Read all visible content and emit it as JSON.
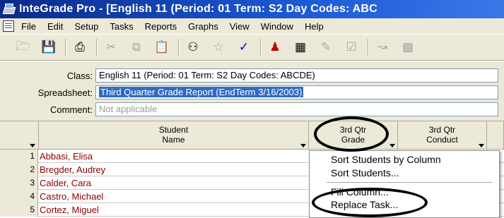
{
  "window": {
    "title": "InteGrade Pro - [English 11 (Period: 01 Term: S2 Day Codes: ABC"
  },
  "menubar": {
    "items": [
      "File",
      "Edit",
      "Setup",
      "Tasks",
      "Reports",
      "Graphs",
      "View",
      "Window",
      "Help"
    ]
  },
  "toolbar": {
    "icons": [
      "open-folder-icon",
      "save-icon",
      "print-icon",
      "cut-icon",
      "copy-icon",
      "paste-icon",
      "find-icon",
      "find-next-icon",
      "spell-check-icon",
      "students-icon",
      "grid-icon",
      "new-assignment-icon",
      "edit-assignment-icon",
      "line-chart-icon",
      "bar-chart-icon"
    ]
  },
  "info": {
    "class_label": "Class:",
    "class_value": "English 11 (Period: 01 Term: S2 Day Codes: ABCDE)",
    "spreadsheet_label": "Spreadsheet:",
    "spreadsheet_value": "Third Quarter Grade Report (EndTerm 3/16/2003)",
    "comment_label": "Comment:",
    "comment_value": "Not applicable"
  },
  "grid": {
    "columns": [
      {
        "line1": "Student",
        "line2": "Name"
      },
      {
        "line1": "3rd Qtr",
        "line2": "Grade"
      },
      {
        "line1": "3rd Qtr",
        "line2": "Conduct"
      }
    ],
    "rows": [
      {
        "num": "1",
        "name": "Abbasi, Elisa"
      },
      {
        "num": "2",
        "name": "Bregder, Audrey"
      },
      {
        "num": "3",
        "name": "Calder, Cara"
      },
      {
        "num": "4",
        "name": "Castro, Michael"
      },
      {
        "num": "5",
        "name": "Cortez, Miguel"
      }
    ]
  },
  "context_menu": {
    "items": [
      "Sort Students by Column",
      "Sort Students...",
      "Fill Column...",
      "Replace Task..."
    ]
  },
  "colors": {
    "title_bar": "#1d5ad6",
    "student_name": "#8b0000",
    "selection": "#316ac5"
  }
}
